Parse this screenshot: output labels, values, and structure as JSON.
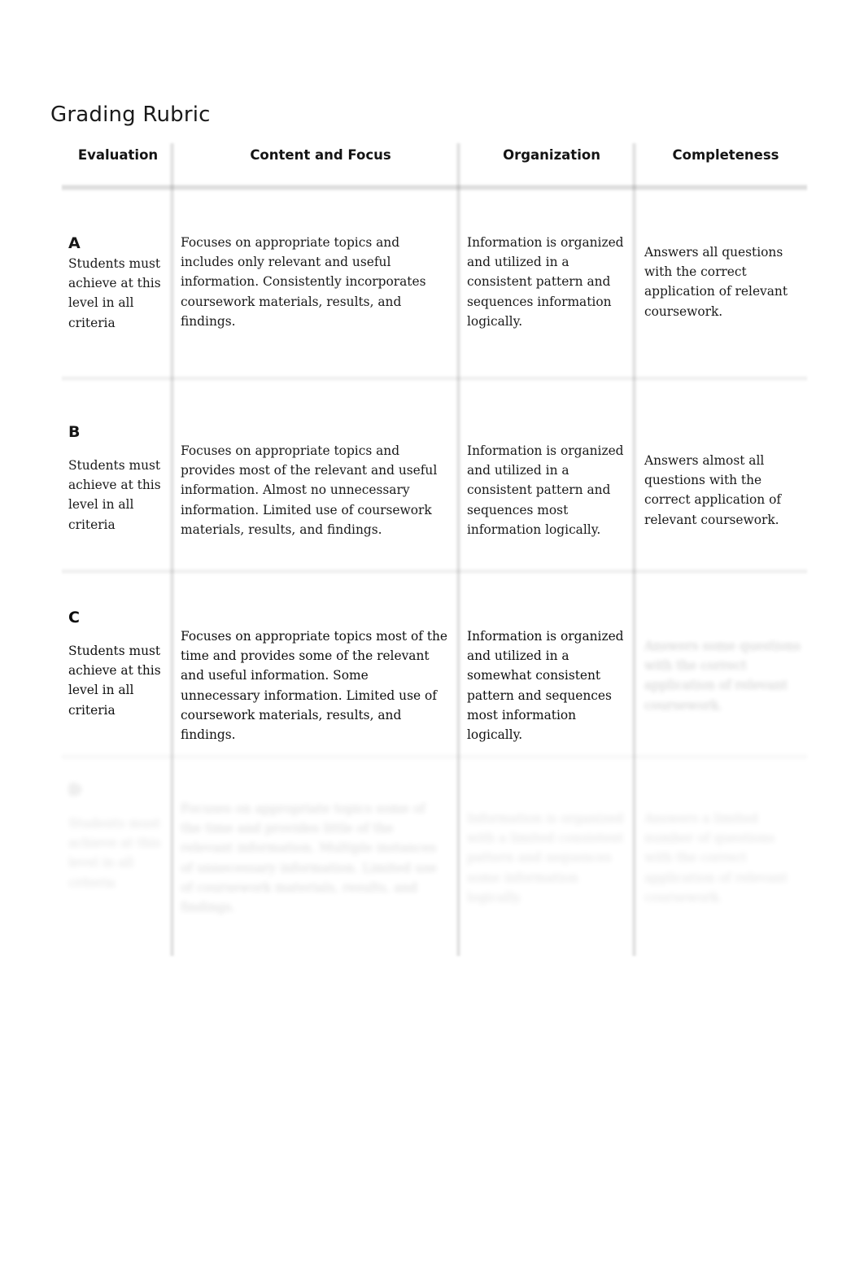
{
  "document": {
    "title": "Grading Rubric"
  },
  "table": {
    "headers": [
      "Evaluation",
      "Content and Focus",
      "Organization",
      "Completeness"
    ],
    "rows": [
      {
        "grade": "A",
        "criteria_note": "Students must achieve at this level in all criteria",
        "content_and_focus": "Focuses on appropriate topics and includes only relevant and useful information. Consistently incorporates coursework materials, results, and findings.",
        "organization": "Information is organized and utilized in a consistent pattern and sequences information logically.",
        "completeness": "Answers all questions with the correct application of relevant coursework."
      },
      {
        "grade": "B",
        "criteria_note": "Students must achieve at this level in all criteria",
        "content_and_focus": "Focuses on appropriate topics and provides most of the relevant and useful information. Almost no unnecessary information. Limited use of coursework materials, results, and findings.",
        "organization": "Information is organized and utilized in a consistent pattern and sequences most information logically.",
        "completeness": "Answers almost all questions with the correct application of relevant coursework."
      },
      {
        "grade": "C",
        "criteria_note": "Students must achieve at this level in all criteria",
        "content_and_focus": "Focuses on appropriate topics most of the time and provides some of the relevant and useful information. Some unnecessary information. Limited use of coursework materials, results, and findings.",
        "organization": "Information is organized and utilized in a somewhat consistent pattern and sequences most information logically.",
        "completeness": "Answers some questions with the correct application of relevant coursework."
      },
      {
        "grade": "D",
        "criteria_note": "Students must achieve at this level in all criteria",
        "content_and_focus": "Focuses on appropriate topics some of the time and provides little of the relevant information. Multiple instances of unnecessary information. Limited use of coursework materials, results, and findings.",
        "organization": "Information is organized with a limited consistent pattern and sequences some information logically.",
        "completeness": "Answers a limited number of questions with the correct application of relevant coursework."
      }
    ]
  }
}
